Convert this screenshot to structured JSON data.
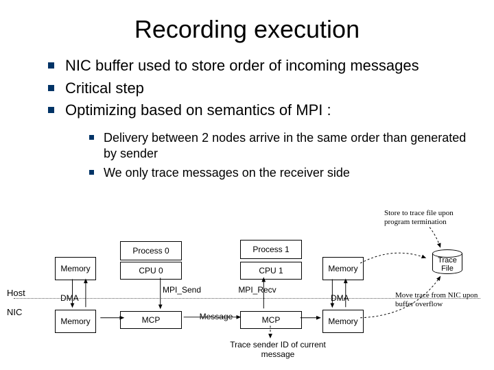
{
  "title": "Recording execution",
  "bullets": {
    "b1": "NIC buffer used to store order of incoming messages",
    "b2": "Critical step",
    "b3": "Optimizing based on semantics of MPI :"
  },
  "subbullets": {
    "s1": "Delivery between 2 nodes arrive in the same order than generated by sender",
    "s2": "We only trace messages on the receiver side"
  },
  "diagram": {
    "side_host": "Host",
    "side_nic": "NIC",
    "process0": "Process 0",
    "process1": "Process 1",
    "memory": "Memory",
    "cpu0": "CPU 0",
    "cpu1": "CPU 1",
    "dma": "DMA",
    "mcp": "MCP",
    "mpi_send": "MPI_Send",
    "mpi_recv": "MPI_Recv",
    "message": "Message",
    "trace_file": "Trace\nFile",
    "note_store": "Store to trace file upon program termination",
    "note_move": "Move trace from NIC upon buffer overflow",
    "note_trace": "Trace sender ID of current message"
  }
}
